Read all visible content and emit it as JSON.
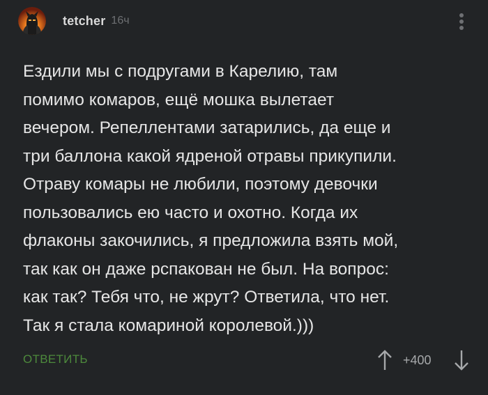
{
  "comment": {
    "author": "tetcher",
    "time": "16ч",
    "lines": [
      "Ездили мы с подругами в Карелию, там",
      "помимо комаров, ещё мошка вылетает",
      "вечером. Репеллентами затарились, да еще и",
      "три баллона какой ядреной отравы прикупили.",
      "Отраву комары не любили, поэтому девочки",
      "пользовались ею часто и охотно. Когда их",
      "флаконы закочились, я предложила взять мой,",
      "так как он даже рспакован не был. На вопрос:",
      "как так? Тебя что, не жрут? Ответила, что нет.",
      "Так я стала комариной королевой.)))"
    ],
    "reply_label": "ОТВЕТИТЬ",
    "score": "+400"
  },
  "icons": {
    "avatar": "avatar-icon",
    "more": "more-vertical-icon",
    "upvote": "arrow-up-icon",
    "downvote": "arrow-down-icon"
  },
  "colors": {
    "background": "#222426",
    "text": "#e6e6e6",
    "accent_green": "#4d8a3c",
    "muted": "#6e7073"
  }
}
